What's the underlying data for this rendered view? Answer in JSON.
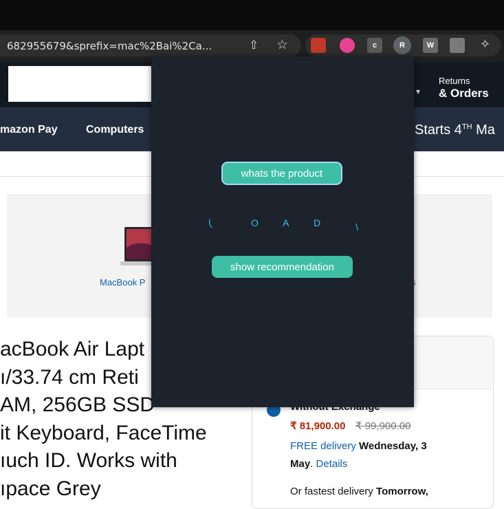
{
  "browser": {
    "url": "682955679&sprefix=mac%2Bai%2Ca...",
    "extensions": [
      {
        "name": "chart-ext-icon",
        "label": "",
        "color": "#c0392b"
      },
      {
        "name": "color-wheel-ext-icon",
        "label": "",
        "color": "#e84393"
      },
      {
        "name": "c-ext-icon",
        "label": "c",
        "color": "#5a5a5a"
      },
      {
        "name": "r-profile-icon",
        "label": "R",
        "color": "#5f6368"
      },
      {
        "name": "w-ext-icon",
        "label": "W",
        "color": "#6a6a6a"
      },
      {
        "name": "book-ext-icon",
        "label": "",
        "color": "#7a7a7a"
      }
    ]
  },
  "amazon": {
    "returns_top": "Returns",
    "returns_bottom": "& Orders",
    "nav": [
      "mazon Pay",
      "Computers"
    ],
    "promo_prefix": "Starts 4",
    "promo_sup": "TH",
    "promo_suffix": " Ma",
    "product_tile_label": "MacBook P",
    "tile_tail": "s",
    "title_lines": [
      "acBook Air Lapt",
      "ı/33.74 cm Reti",
      "AM, 256GB SSD",
      "it Keyboard, FaceTime",
      "ıuch ID. Works with",
      "ıpace Grey"
    ],
    "exchange_label": "Without Exchange",
    "price": "₹ 81,900.00",
    "mrp": "₹ 99,900.00",
    "delivery_free": "FREE delivery",
    "delivery_date": "Wednesday, 3",
    "delivery_month": "May",
    "details_link": "Details",
    "fastest_prefix": "Or fastest delivery",
    "fastest_day": "Tomorrow,"
  },
  "popup": {
    "button_product": "whats the product",
    "loading": [
      "(",
      "O",
      "A",
      "D",
      "\\"
    ],
    "button_recommendation": "show recommendation"
  }
}
